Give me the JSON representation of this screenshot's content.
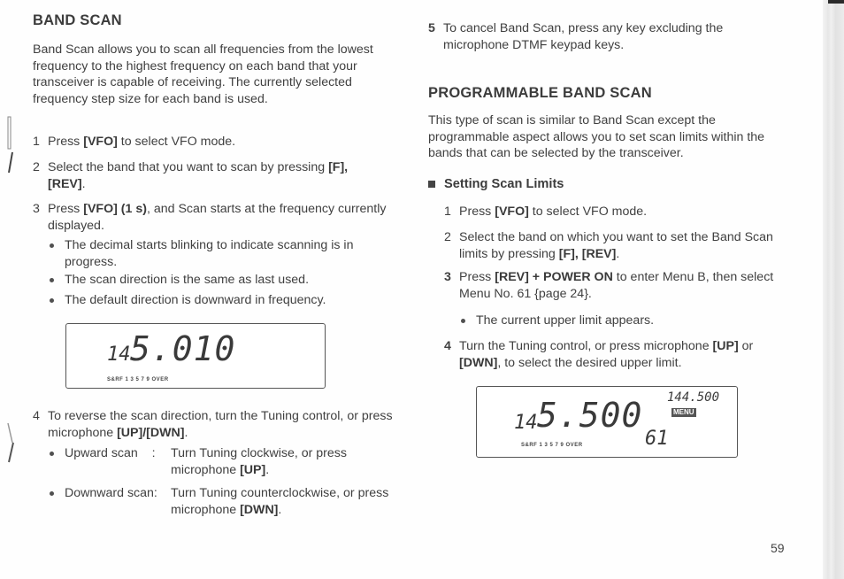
{
  "left": {
    "title": "BAND SCAN",
    "intro": "Band Scan allows you to scan all frequencies from the lowest frequency to the highest frequency on each band that your transceiver is capable of receiving.  The currently selected frequency step size for each band is used.",
    "step1": {
      "num": "1",
      "pre": "Press ",
      "bold": "[VFO]",
      "post": " to select VFO mode."
    },
    "step2": {
      "num": "2",
      "pre": "Select the band that you want to scan by pressing ",
      "bold": "[F], [REV]",
      "post": "."
    },
    "step3": {
      "num": "3",
      "pre": "Press ",
      "bold": "[VFO] (1 s)",
      "post": ", and Scan starts at the frequency currently displayed."
    },
    "bullets3": [
      "The decimal starts blinking to indicate scanning is in progress.",
      "The scan direction is the same as last used.",
      "The default direction is downward in frequency."
    ],
    "lcd": {
      "main": "145.010",
      "small_prefix": "14",
      "big": "5.010",
      "meter": "S&RF    1  3  5  7  9 OVER"
    },
    "step4": {
      "num": "4",
      "pre": "To reverse the scan direction, turn the Tuning control, or press microphone ",
      "bold": "[UP]/[DWN]",
      "post": "."
    },
    "bullets4": [
      {
        "label": "Upward scan    :",
        "pre": "Turn Tuning clockwise, or press microphone ",
        "bold": "[UP]",
        "post": "."
      },
      {
        "label": "Downward scan:",
        "pre": "Turn Tuning counterclockwise, or press microphone ",
        "bold": "[DWN]",
        "post": "."
      }
    ]
  },
  "right": {
    "step5": {
      "num": "5",
      "pre": "To cancel Band Scan, press any key excluding the microphone DTMF keypad keys."
    },
    "title": "PROGRAMMABLE BAND SCAN",
    "intro": "This type of scan is similar to Band Scan except the programmable aspect allows you to set scan limits within the bands that can be selected by the transceiver.",
    "subhead": "Setting Scan Limits",
    "steps": [
      {
        "num": "1",
        "pre": "Press ",
        "bold": "[VFO]",
        "post": " to select VFO mode."
      },
      {
        "num": "2",
        "pre": "Select the band on which you want to set the Band Scan limits by pressing ",
        "bold": "[F], [REV]",
        "post": "."
      },
      {
        "num": "3",
        "pre": "Press ",
        "bold": "[REV] +  POWER ON",
        "post": " to enter Menu B, then select Menu No. 61 {page 24}."
      },
      {
        "num": "4",
        "pre": "Turn the Tuning control, or press microphone ",
        "bold": "[UP]",
        "post": " or ",
        "bold2": "[DWN]",
        "post2": ", to select the desired upper limit."
      }
    ],
    "bullet3": "The current upper limit appears.",
    "lcd": {
      "small_prefix": "14",
      "big": "5.500",
      "sub_freq": "144.500",
      "menu_label": "MENU",
      "menu_no": "61",
      "meter": "S&RF    1  3  5  7  9 OVER"
    }
  },
  "page_number": "59"
}
